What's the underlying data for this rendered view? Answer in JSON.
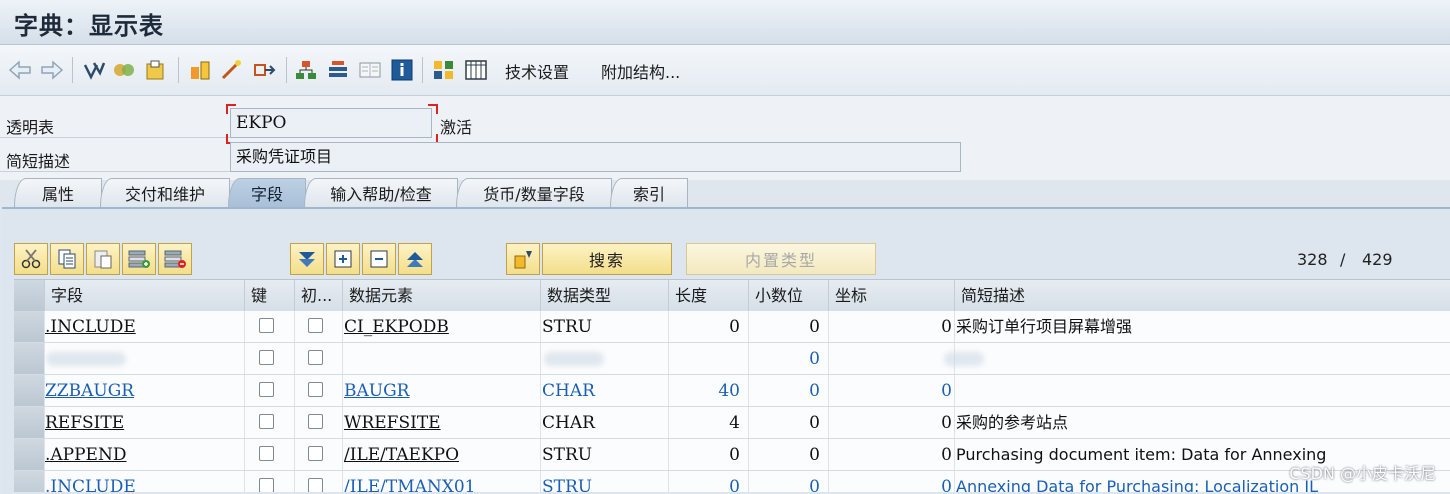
{
  "window": {
    "title": "字典：显示表"
  },
  "toolbar": {
    "icons": [
      "back-arrow-icon",
      "forward-arrow-icon",
      "other-object-icon",
      "display-change-icon",
      "activate-icon",
      "check-icon",
      "where-used-icon",
      "object-list-icon",
      "hierarchy-icon",
      "navigation-window-icon",
      "display-object-list-icon",
      "info-icon",
      "contents-icon",
      "table-view-icon"
    ],
    "tech_settings": "技术设置",
    "append_structure": "附加结构..."
  },
  "form": {
    "table_label": "透明表",
    "table_name": "EKPO",
    "status": "激活",
    "desc_label": "简短描述",
    "desc_value": "采购凭证项目"
  },
  "tabs": [
    {
      "label": "属性"
    },
    {
      "label": "交付和维护"
    },
    {
      "label": "字段",
      "active": true
    },
    {
      "label": "输入帮助/检查"
    },
    {
      "label": "货币/数量字段"
    },
    {
      "label": "索引"
    }
  ],
  "grid_toolbar": {
    "search": "搜索",
    "builtin_type": "内置类型",
    "position": "328",
    "separator": "/",
    "total": "429"
  },
  "table": {
    "headers": [
      "字段",
      "键",
      "初...",
      "数据元素",
      "数据类型",
      "长度",
      "小数位",
      "坐标",
      "简短描述"
    ],
    "rows": [
      {
        "field": ".INCLUDE",
        "elem": "CI_EKPODB",
        "type": "STRU",
        "len": "0",
        "dec": "0",
        "coord": "0",
        "desc": "采购订单行项目屏幕增强",
        "blue": false
      },
      {
        "field": "",
        "elem": "",
        "type": "",
        "len": "",
        "dec": "0",
        "coord": "",
        "desc": "",
        "blue": true,
        "blurred": true
      },
      {
        "field": "ZZBAUGR",
        "elem": "BAUGR",
        "type": "CHAR",
        "len": "40",
        "dec": "0",
        "coord": "0",
        "desc": "",
        "blue": true
      },
      {
        "field": "REFSITE",
        "elem": "WREFSITE",
        "type": "CHAR",
        "len": "4",
        "dec": "0",
        "coord": "0",
        "desc": "采购的参考站点",
        "blue": false
      },
      {
        "field": ".APPEND",
        "elem": "/ILE/TAEKPO",
        "type": "STRU",
        "len": "0",
        "dec": "0",
        "coord": "0",
        "desc": "Purchasing document item: Data for Annexing",
        "blue": false
      },
      {
        "field": ".INCLUDE",
        "elem": "/ILE/TMANX01",
        "type": "STRU",
        "len": "0",
        "dec": "0",
        "coord": "0",
        "desc": "Annexing Data for Purchasing: Localization IL",
        "blue": true
      }
    ]
  },
  "watermark": "CSDN @小皮卡沃尼",
  "colors": {
    "link_blue": "#1a5fb4",
    "accent_red": "#d22222",
    "button_yellow": "#f6e39a"
  }
}
